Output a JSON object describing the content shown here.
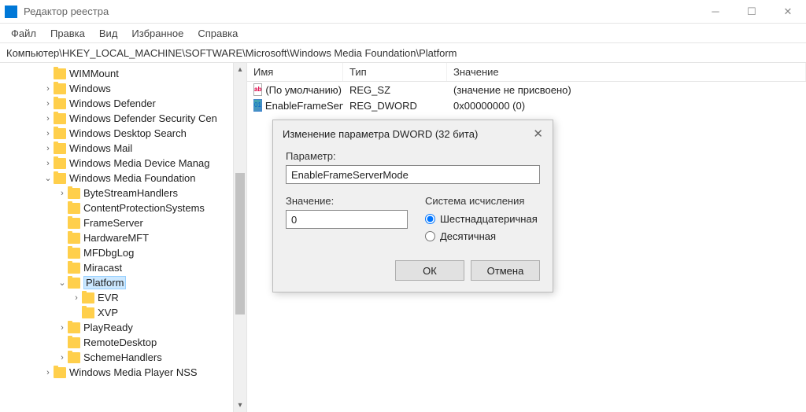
{
  "window": {
    "title": "Редактор реестра"
  },
  "menubar": {
    "file": "Файл",
    "edit": "Правка",
    "view": "Вид",
    "favorites": "Избранное",
    "help": "Справка"
  },
  "addressbar": {
    "path": "Компьютер\\HKEY_LOCAL_MACHINE\\SOFTWARE\\Microsoft\\Windows Media Foundation\\Platform"
  },
  "list": {
    "headers": {
      "name": "Имя",
      "type": "Тип",
      "value": "Значение"
    },
    "rows": [
      {
        "name": "(По умолчанию)",
        "type": "REG_SZ",
        "value": "(значение не присвоено)",
        "kind": "str"
      },
      {
        "name": "EnableFrameServ...",
        "type": "REG_DWORD",
        "value": "0x00000000 (0)",
        "kind": "dw"
      }
    ]
  },
  "tree": {
    "items": [
      {
        "depth": 3,
        "exp": "",
        "label": "WIMMount"
      },
      {
        "depth": 3,
        "exp": "›",
        "label": "Windows"
      },
      {
        "depth": 3,
        "exp": "›",
        "label": "Windows Defender"
      },
      {
        "depth": 3,
        "exp": "›",
        "label": "Windows Defender Security Cen"
      },
      {
        "depth": 3,
        "exp": "›",
        "label": "Windows Desktop Search"
      },
      {
        "depth": 3,
        "exp": "›",
        "label": "Windows Mail"
      },
      {
        "depth": 3,
        "exp": "›",
        "label": "Windows Media Device Manag"
      },
      {
        "depth": 3,
        "exp": "⌄",
        "label": "Windows Media Foundation"
      },
      {
        "depth": 4,
        "exp": "›",
        "label": "ByteStreamHandlers"
      },
      {
        "depth": 4,
        "exp": "",
        "label": "ContentProtectionSystems"
      },
      {
        "depth": 4,
        "exp": "",
        "label": "FrameServer"
      },
      {
        "depth": 4,
        "exp": "",
        "label": "HardwareMFT"
      },
      {
        "depth": 4,
        "exp": "",
        "label": "MFDbgLog"
      },
      {
        "depth": 4,
        "exp": "",
        "label": "Miracast"
      },
      {
        "depth": 4,
        "exp": "⌄",
        "label": "Platform",
        "selected": true,
        "open": true
      },
      {
        "depth": 5,
        "exp": "›",
        "label": "EVR"
      },
      {
        "depth": 5,
        "exp": "",
        "label": "XVP"
      },
      {
        "depth": 4,
        "exp": "›",
        "label": "PlayReady"
      },
      {
        "depth": 4,
        "exp": "",
        "label": "RemoteDesktop"
      },
      {
        "depth": 4,
        "exp": "›",
        "label": "SchemeHandlers"
      },
      {
        "depth": 3,
        "exp": "›",
        "label": "Windows Media Player NSS"
      }
    ]
  },
  "dialog": {
    "title": "Изменение параметра DWORD (32 бита)",
    "param_label": "Параметр:",
    "param_value": "EnableFrameServerMode",
    "value_label": "Значение:",
    "value_value": "0",
    "base_label": "Система исчисления",
    "radio_hex": "Шестнадцатеричная",
    "radio_dec": "Десятичная",
    "ok": "ОК",
    "cancel": "Отмена"
  }
}
